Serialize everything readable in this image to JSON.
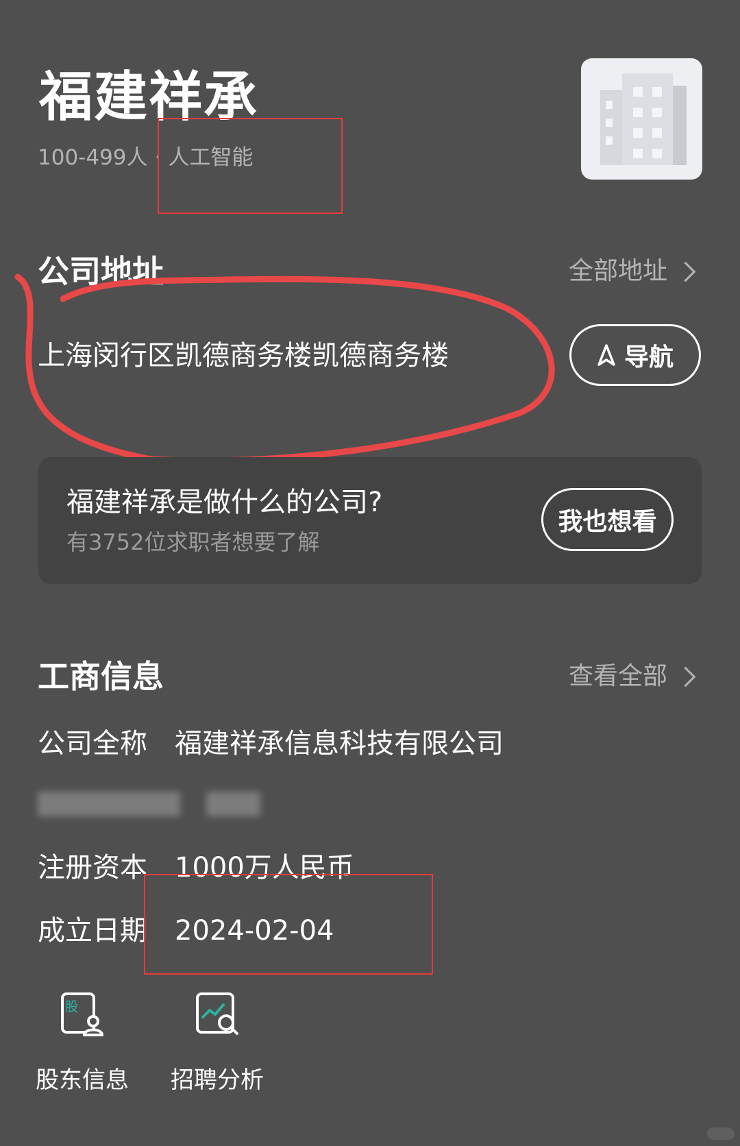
{
  "company": {
    "name": "福建祥承",
    "size": "100-499人",
    "separator": "·",
    "industry": "人工智能"
  },
  "address_section": {
    "title": "公司地址",
    "link_label": "全部地址",
    "address": "上海闵行区凯德商务楼凯德商务楼",
    "nav_label": "导航"
  },
  "qa_card": {
    "title": "福建祥承是做什么的公司?",
    "subtitle": "有3752位求职者想要了解",
    "button_label": "我也想看"
  },
  "business_section": {
    "title": "工商信息",
    "link_label": "查看全部",
    "rows": [
      {
        "label": "公司全称",
        "value": "福建祥承信息科技有限公司"
      },
      {
        "label": "注册资本",
        "value": "1000万人民币"
      },
      {
        "label": "成立日期",
        "value": "2024-02-04"
      }
    ]
  },
  "tools": [
    {
      "label": "股东信息",
      "icon": "shareholder-icon",
      "icon_text": "股"
    },
    {
      "label": "招聘分析",
      "icon": "recruitment-analysis-icon"
    }
  ],
  "colors": {
    "background": "#4f4f4f",
    "card": "#434343",
    "muted_text": "#b4b4b4",
    "annotation_red": "#e53b3b",
    "icon_accent": "#29b5a0"
  }
}
